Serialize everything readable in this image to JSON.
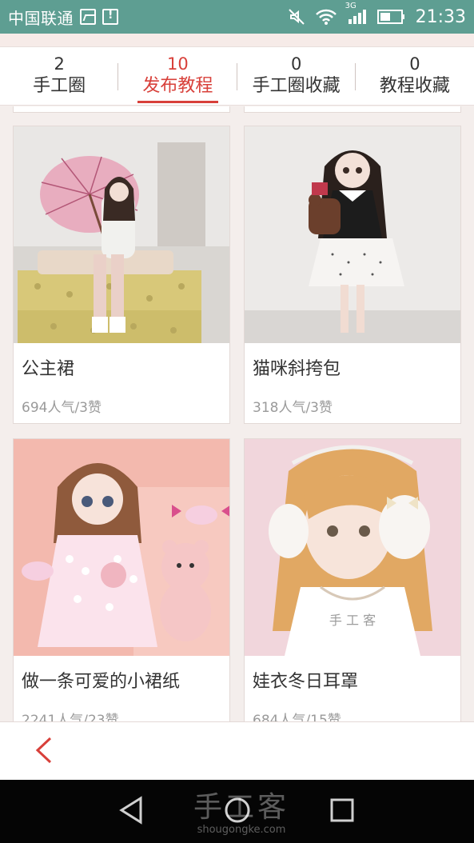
{
  "status_bar": {
    "carrier": "中国联通",
    "network": "3G",
    "time": "21:33"
  },
  "tabs": [
    {
      "count": "2",
      "label": "手工圈",
      "active": false
    },
    {
      "count": "10",
      "label": "发布教程",
      "active": true
    },
    {
      "count": "0",
      "label": "手工圈收藏",
      "active": false
    },
    {
      "count": "0",
      "label": "教程收藏",
      "active": false
    }
  ],
  "tutorials": [
    {
      "title": "公主裙",
      "stats": "694人气/3赞"
    },
    {
      "title": "猫咪斜挎包",
      "stats": "318人气/3赞"
    },
    {
      "title": "做一条可爱的小裙纸",
      "stats": "2241人气/23赞"
    },
    {
      "title": "娃衣冬日耳罩",
      "stats": "684人气/15赞"
    }
  ],
  "watermark": {
    "chinese": "手工客",
    "domain": "shougongke.com"
  },
  "colors": {
    "accent": "#d8403a",
    "status_bar": "#5e9e92",
    "background": "#f4eeec"
  }
}
